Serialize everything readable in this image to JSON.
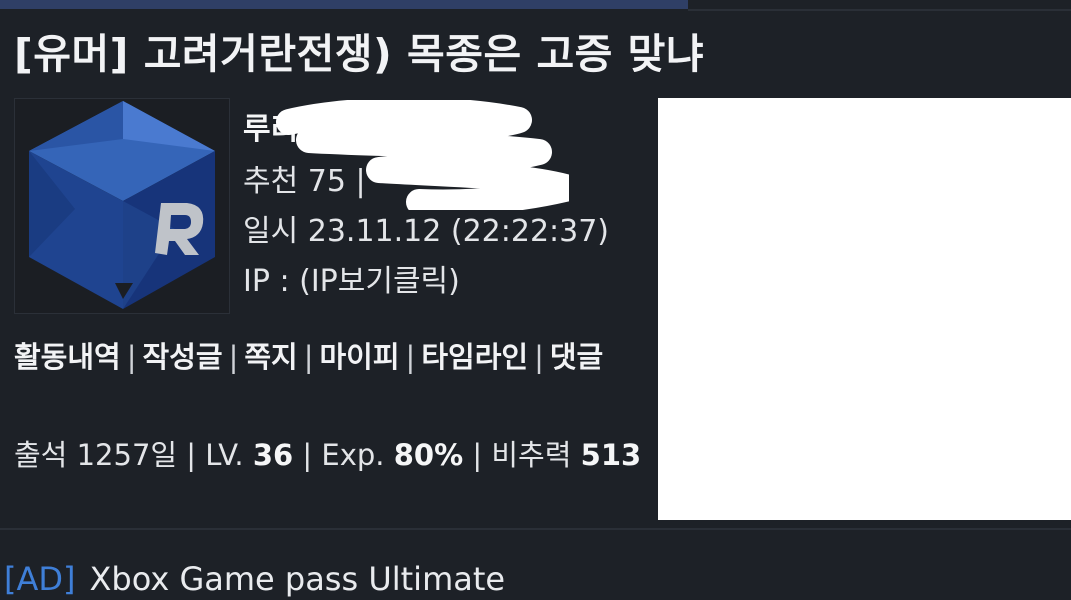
{
  "post": {
    "title": "[유머] 고려거란전쟁) 목종은 고증 맞냐"
  },
  "author": {
    "nickname": "루리웹-  2",
    "recommend": "추천 75 | ",
    "date": "일시 23.11.12 (22:22:37)",
    "ip": "IP : (IP보기클릭)"
  },
  "user_links": {
    "items": [
      "활동내역",
      "작성글",
      "쪽지",
      "마이피",
      "타임라인",
      "댓글"
    ],
    "separator": "|"
  },
  "stats": {
    "attendance_label": "출석",
    "attendance_value": "1257일",
    "level_label": "LV.",
    "level_value": "36",
    "exp_label": "Exp.",
    "exp_value": "80%",
    "bichu_label": "비추력",
    "bichu_value": "513"
  },
  "ad": {
    "tag": "[AD]",
    "text": "Xbox Game pass Ultimate"
  },
  "colors": {
    "background": "#1d2127",
    "ad_tag": "#3f7fd8",
    "avatar_blue": "#1f3f85"
  },
  "icons": {
    "avatar": "r-cube-logo-icon"
  }
}
